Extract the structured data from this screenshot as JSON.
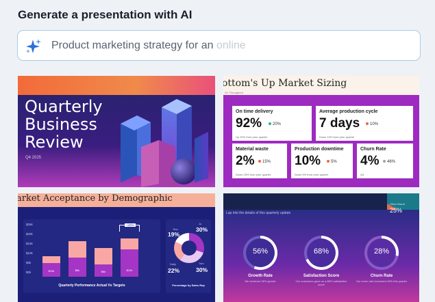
{
  "header": {
    "title": "Generate a presentation with AI"
  },
  "prompt": {
    "typed": "Product marketing strategy for an ",
    "ghost": "online"
  },
  "icons": {
    "prompt": "sparkle-icon"
  },
  "colors": {
    "accent": "#5b8fd6",
    "purple": "#9d2bc0",
    "navy": "#1c1f78"
  },
  "cards": {
    "quarterly": {
      "title_line1": "Quarterly",
      "title_line2": "Business",
      "title_line3": "Review",
      "date": "Q4 2025"
    },
    "market_sizing": {
      "heading": "ottom's Up Market Sizing",
      "subtitle": "Q1 Throughout",
      "kpis": [
        {
          "label": "On time delivery",
          "value": "92%",
          "change": "20%",
          "note": "Up 20% from prior quarter"
        },
        {
          "label": "Average production cycle",
          "value": "7 days",
          "change": "10%",
          "note": "Down 10% from prior quarter"
        },
        {
          "label": "Material waste",
          "value": "2%",
          "change": "15%",
          "note": "Down 15% from prior quarter"
        },
        {
          "label": "Production downtime",
          "value": "10%",
          "change": "5%",
          "note": "Down 5% from prior quarter"
        },
        {
          "label": "Churn Rate",
          "value": "4%",
          "change": "46%",
          "note": "Q4"
        }
      ]
    },
    "market_acceptance": {
      "heading": "arket Acceptance by Demographic",
      "chart_title": "Quarterly Performance Actual Vs Targets",
      "donut_title": "Percentage by Sales Rep",
      "y_ticks": [
        "$25k",
        "$20k",
        "$15k",
        "$10k",
        "$5k",
        "$0k"
      ],
      "badge": "+42%",
      "bar_labels": [
        "$10k",
        "$6k",
        "$6k",
        "$12k"
      ],
      "donut": [
        {
          "label": "Tina",
          "value": "19%"
        },
        {
          "label": "Daily",
          "value": "22%"
        },
        {
          "label": "Jo",
          "value": "30%"
        },
        {
          "label": "Tom",
          "value": "30%"
        }
      ]
    },
    "growth": {
      "subtitle": "Lap into the details of this quarterly update",
      "other": {
        "label": "Other Brand",
        "value": "25%"
      },
      "rings": [
        {
          "pct": "56%",
          "label": "Growth Rate",
          "note": "We achieved 56% growth"
        },
        {
          "pct": "68%",
          "label": "Satisfaction Score",
          "note": "Our customers gave us a 68% satisfaction score"
        },
        {
          "pct": "28%",
          "label": "Churn Rate",
          "note": "Our churn rate increased 28% this quarter"
        }
      ]
    }
  }
}
